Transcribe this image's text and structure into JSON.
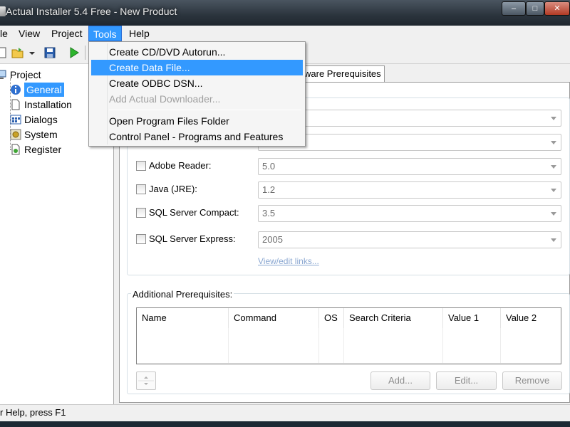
{
  "window": {
    "title": "Actual Installer 5.4 Free - New Product"
  },
  "caption_buttons": {
    "minimize": "‒",
    "maximize": "□",
    "close": "✕"
  },
  "menubar": {
    "items": [
      "le",
      "View",
      "Project",
      "Tools",
      "Help"
    ],
    "open": "Tools"
  },
  "tools_menu": {
    "items": [
      {
        "label": "Create CD/DVD Autorun...",
        "state": "normal"
      },
      {
        "label": "Create Data File...",
        "state": "highlighted"
      },
      {
        "label": "Create ODBC DSN...",
        "state": "normal"
      },
      {
        "label": "Add Actual Downloader...",
        "state": "disabled"
      },
      {
        "label": "Open Program Files Folder",
        "state": "normal"
      },
      {
        "label": "Control Panel - Programs and Features",
        "state": "normal"
      }
    ]
  },
  "tree": {
    "root": "Project",
    "children": [
      "General",
      "Installation",
      "Dialogs",
      "System",
      "Register"
    ],
    "selected": "General"
  },
  "tab": {
    "label": "ware Prerequisites"
  },
  "prerequisites": [
    {
      "label": "Adobe Reader:",
      "version": "5.0"
    },
    {
      "label": "Java (JRE):",
      "version": "1.2"
    },
    {
      "label": "SQL Server Compact:",
      "version": "3.5"
    },
    {
      "label": "SQL Server Express:",
      "version": "2005"
    }
  ],
  "links": {
    "view_edit": "View/edit links..."
  },
  "additional": {
    "title": "Additional Prerequisites:",
    "columns": [
      "Name",
      "Command",
      "OS",
      "Search Criteria",
      "Value 1",
      "Value 2"
    ]
  },
  "buttons": {
    "add": "Add...",
    "edit": "Edit...",
    "remove": "Remove"
  },
  "statusbar": {
    "text": "r Help, press F1"
  }
}
